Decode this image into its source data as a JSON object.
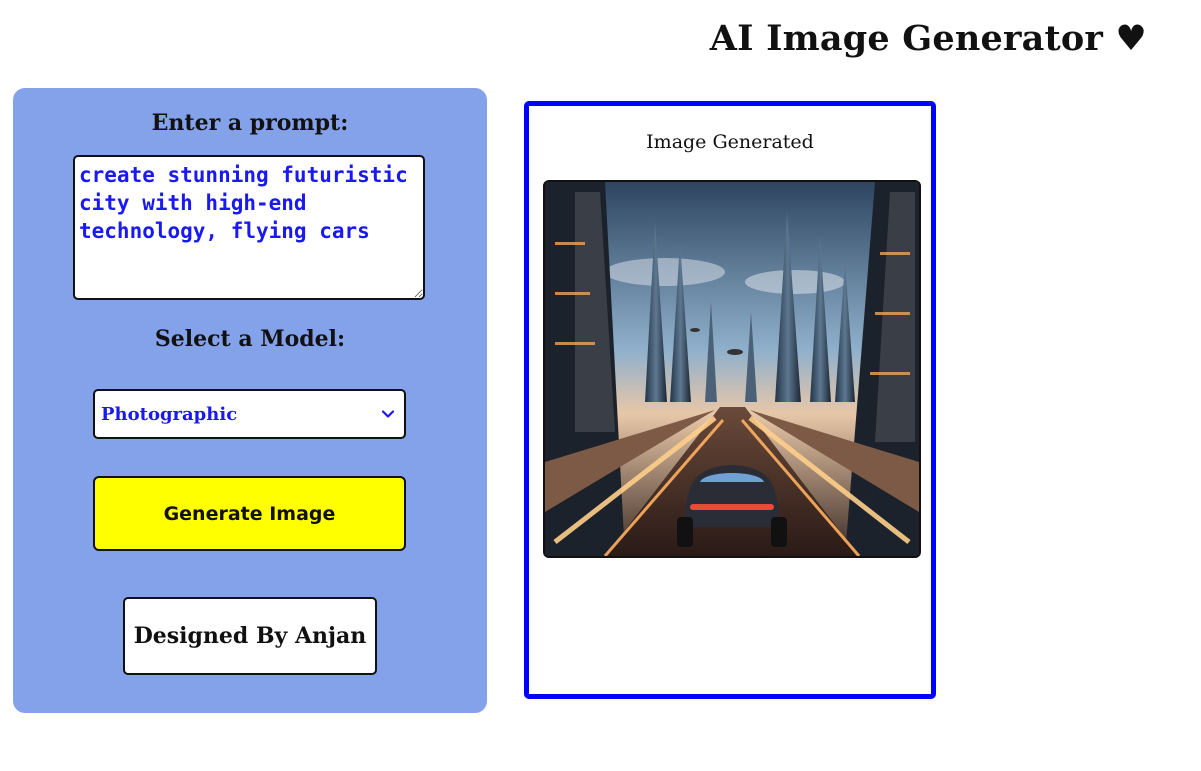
{
  "header": {
    "title": "AI Image Generator ♥"
  },
  "form": {
    "prompt_label": "Enter a prompt:",
    "prompt_value": "create stunning futuristic city with high-end technology, flying cars",
    "model_label": "Select a Model:",
    "model_selected": "Photographic",
    "generate_label": "Generate Image",
    "credit_text": "Designed By Anjan"
  },
  "output": {
    "label": "Image Generated",
    "image_icon": "futuristic-city-image"
  },
  "colors": {
    "panel_bg": "#84a2ea",
    "accent_blue": "#0000ff",
    "input_text": "#1a1af0",
    "button_bg": "#ffff00"
  }
}
